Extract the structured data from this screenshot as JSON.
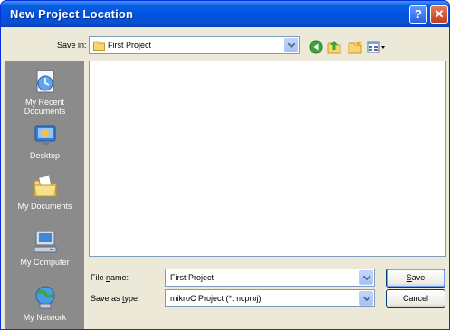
{
  "window": {
    "title": "New Project Location",
    "help_label": "?",
    "close_label": "✕"
  },
  "savein": {
    "label": "Save in:",
    "value": "First Project"
  },
  "toolbar": {
    "icons": [
      "back-icon",
      "up-folder-icon",
      "new-folder-icon",
      "views-menu-icon"
    ]
  },
  "places": [
    {
      "label": "My Recent Documents",
      "icon": "recent-documents-icon"
    },
    {
      "label": "Desktop",
      "icon": "desktop-icon"
    },
    {
      "label": "My Documents",
      "icon": "my-documents-icon"
    },
    {
      "label": "My Computer",
      "icon": "my-computer-icon"
    },
    {
      "label": "My Network",
      "icon": "my-network-icon"
    }
  ],
  "filename": {
    "label_pre": "File ",
    "label_u": "n",
    "label_post": "ame:",
    "value": "First Project"
  },
  "savetype": {
    "label_pre": "Save as ",
    "label_u": "t",
    "label_post": "ype:",
    "value": "mikroC Project (*.mcproj)"
  },
  "buttons": {
    "save_u": "S",
    "save_rest": "ave",
    "cancel": "Cancel"
  }
}
